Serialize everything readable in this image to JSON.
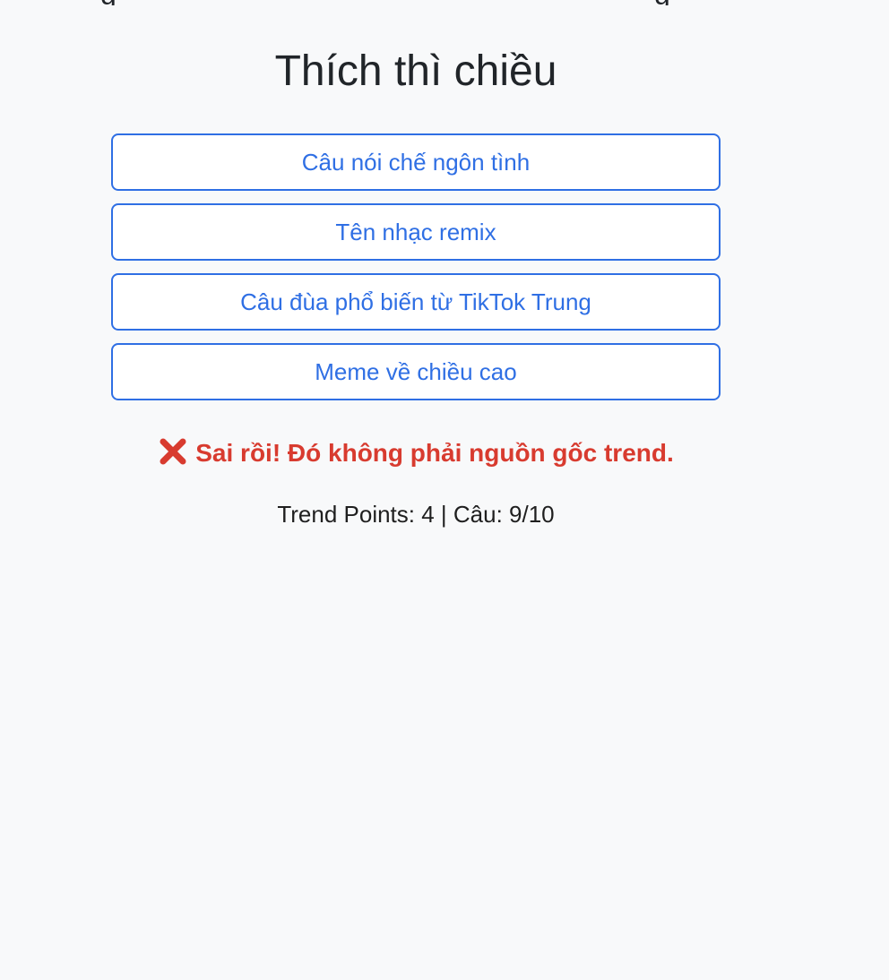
{
  "quiz": {
    "title": "Thích thì chiều",
    "options": [
      "Câu nói chế ngôn tình",
      "Tên nhạc remix",
      "Câu đùa phổ biến từ TikTok Trung",
      "Meme về chiều cao"
    ],
    "feedback_text": "Sai rồi! Đó không phải nguồn gốc trend.",
    "feedback_icon": "cross-mark-icon",
    "score_text": "Trend Points: 4 | Câu: 9/10"
  },
  "colors": {
    "background": "#f8f9fa",
    "accent": "#2f6fe4",
    "error": "#d83b2f",
    "text": "#212529"
  },
  "top_cutoff": {
    "left_glyph": "g",
    "right_glyph": "g"
  }
}
